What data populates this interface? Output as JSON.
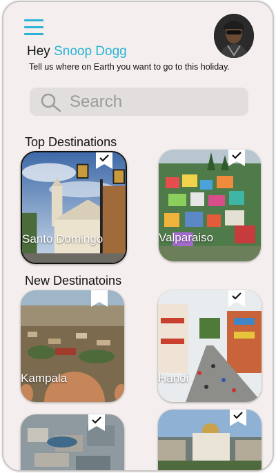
{
  "header": {
    "greeting_prefix": "Hey",
    "user_name": "Snoop Dogg",
    "subtitle": "Tell us where on Earth you want to go to this holiday."
  },
  "search": {
    "placeholder": "Search"
  },
  "sections": {
    "top_title": "Top Destinations",
    "new_title": "New Destinatoins"
  },
  "top_destinations": [
    {
      "name": "Santo Domingo",
      "selected": true
    },
    {
      "name": "Valparaiso",
      "selected": false
    }
  ],
  "new_destinations": [
    {
      "name": "Kampala"
    },
    {
      "name": "Hanoi"
    },
    {
      "name": ""
    },
    {
      "name": ""
    }
  ],
  "colors": {
    "accent": "#29b3d6",
    "background": "#f4efee",
    "search_bg": "#e1dedd"
  },
  "icons": {
    "menu": "hamburger-menu-icon",
    "search": "search-icon",
    "bookmark": "bookmark-check-icon"
  }
}
